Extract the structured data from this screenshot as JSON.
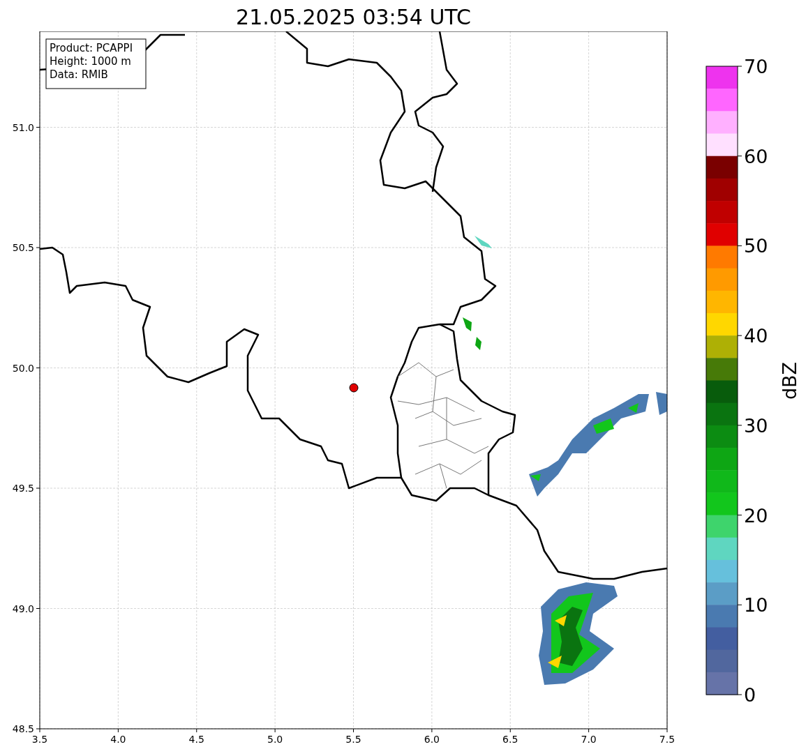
{
  "title": "21.05.2025 03:54 UTC",
  "info_box": [
    "Product: PCAPPI",
    "Height: 1000 m",
    "Data: RMIB"
  ],
  "x_ticks": [
    "3.5",
    "4.0",
    "4.5",
    "5.0",
    "5.5",
    "6.0",
    "6.5",
    "7.0",
    "7.5"
  ],
  "y_ticks": [
    "51.0",
    "50.5",
    "50.0",
    "49.5",
    "49.0",
    "48.5"
  ],
  "colorbar": {
    "label": "dBZ",
    "ticks": [
      "70",
      "60",
      "50",
      "40",
      "30",
      "20",
      "10",
      "0"
    ],
    "bins": [
      {
        "color": "#ee33ee"
      },
      {
        "color": "#ff66ff"
      },
      {
        "color": "#ffb0ff"
      },
      {
        "color": "#ffe0ff"
      },
      {
        "color": "#7a0000"
      },
      {
        "color": "#a00000"
      },
      {
        "color": "#c00000"
      },
      {
        "color": "#e00000"
      },
      {
        "color": "#ff7a00"
      },
      {
        "color": "#ff9a00"
      },
      {
        "color": "#ffb600"
      },
      {
        "color": "#ffd700"
      },
      {
        "color": "#aeb005"
      },
      {
        "color": "#477a08"
      },
      {
        "color": "#085c0c"
      },
      {
        "color": "#0a7410"
      },
      {
        "color": "#0c8c12"
      },
      {
        "color": "#0ea614"
      },
      {
        "color": "#10b81a"
      },
      {
        "color": "#12c61c"
      },
      {
        "color": "#3ed46c"
      },
      {
        "color": "#5fd6c0"
      },
      {
        "color": "#66c0dc"
      },
      {
        "color": "#5b9dc6"
      },
      {
        "color": "#4a7ab0"
      },
      {
        "color": "#435ea0"
      },
      {
        "color": "#51679e"
      },
      {
        "color": "#6673a8"
      }
    ]
  }
}
